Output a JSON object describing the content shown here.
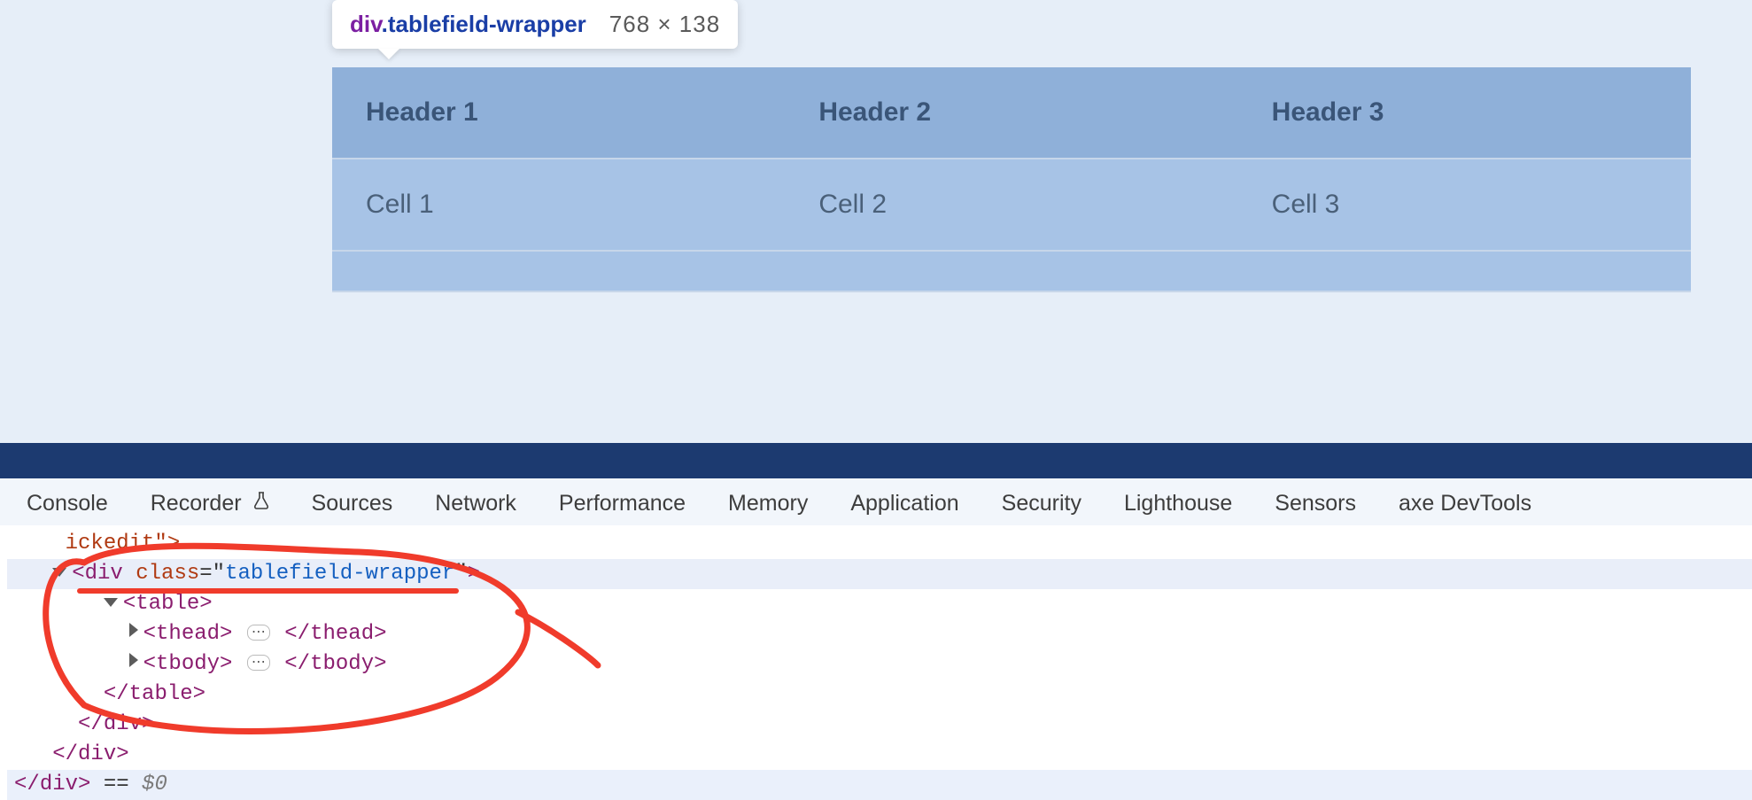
{
  "tooltip": {
    "tag": "div",
    "cls": ".tablefield-wrapper",
    "dims": "768 × 138"
  },
  "table": {
    "headers": [
      "Header 1",
      "Header 2",
      "Header 3"
    ],
    "rows": [
      [
        "Cell 1",
        "Cell 2",
        "Cell 3"
      ]
    ]
  },
  "devtools": {
    "tabs": {
      "console": "Console",
      "recorder": "Recorder",
      "sources": "Sources",
      "network": "Network",
      "performance": "Performance",
      "memory": "Memory",
      "application": "Application",
      "security": "Security",
      "lighthouse": "Lighthouse",
      "sensors": "Sensors",
      "axe": "axe DevTools"
    },
    "dom": {
      "frag_top": "ickedit\">",
      "wrapper_class": "tablefield-wrapper",
      "var_ref": "$0"
    }
  }
}
